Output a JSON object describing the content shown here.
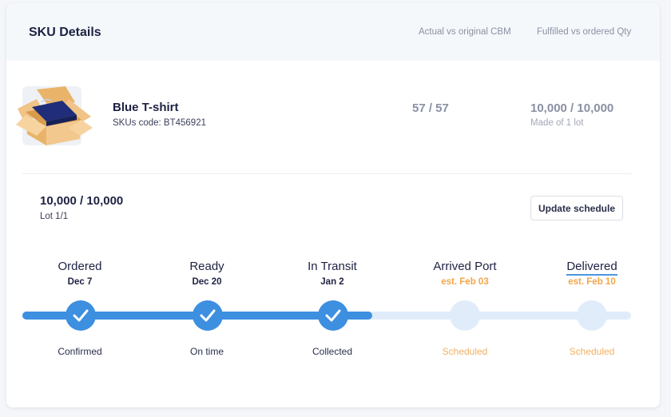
{
  "header": {
    "title": "SKU Details",
    "col_cbm": "Actual vs original CBM",
    "col_qty": "Fulfilled vs ordered Qty"
  },
  "sku": {
    "name": "Blue T-shirt",
    "code": "SKUs code: BT456921",
    "cbm": "57 / 57",
    "qty": "10,000 / 10,000",
    "qty_sub": "Made of 1 lot",
    "thumb_icon": "box-icon"
  },
  "lot": {
    "qty": "10,000 / 10,000",
    "label": "Lot 1/1",
    "update_label": "Update schedule"
  },
  "timeline": {
    "stages": [
      {
        "label": "Ordered",
        "date": "Dec 7",
        "status": "Confirmed",
        "done": true
      },
      {
        "label": "Ready",
        "date": "Dec 20",
        "status": "On time",
        "done": true
      },
      {
        "label": "In Transit",
        "date": "Jan 2",
        "status": "Collected",
        "done": true
      },
      {
        "label": "Arrived Port",
        "date": "est. Feb 03",
        "status": "Scheduled",
        "done": false
      },
      {
        "label": "Delivered",
        "date": "est. Feb 10",
        "status": "Scheduled",
        "done": false
      }
    ]
  },
  "colors": {
    "accent": "#3d8fe0",
    "track_light": "#e0ecfa",
    "estimate": "#f2a54a",
    "text_dark": "#1d2242"
  }
}
